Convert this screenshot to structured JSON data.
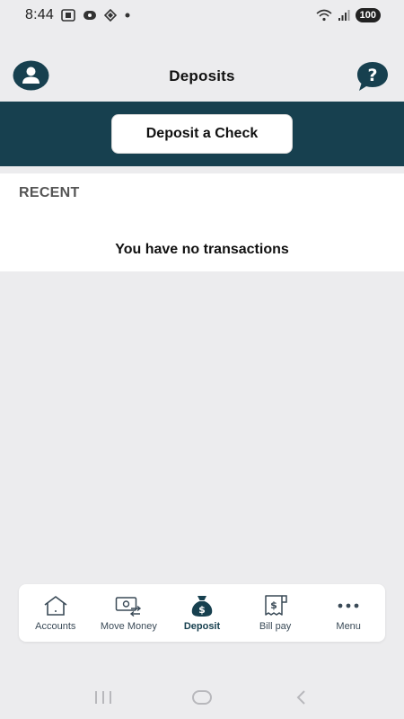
{
  "status_bar": {
    "time": "8:44",
    "battery": "100"
  },
  "header": {
    "title": "Deposits"
  },
  "actions": {
    "deposit_check_label": "Deposit a Check"
  },
  "recent": {
    "title": "RECENT",
    "empty_message": "You have no transactions"
  },
  "bottom_nav": {
    "items": [
      {
        "label": "Accounts",
        "icon": "house-icon"
      },
      {
        "label": "Move Money",
        "icon": "money-transfer-icon"
      },
      {
        "label": "Deposit",
        "icon": "money-bag-icon",
        "active": true
      },
      {
        "label": "Bill pay",
        "icon": "bill-icon"
      },
      {
        "label": "Menu",
        "icon": "more-dots-icon"
      }
    ]
  },
  "colors": {
    "brand_dark": "#17404f",
    "background": "#ececee"
  }
}
